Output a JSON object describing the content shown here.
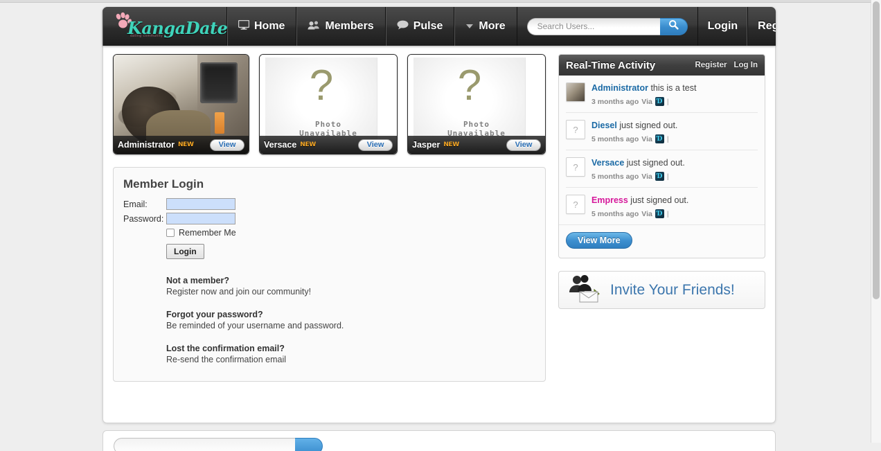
{
  "site": {
    "logo_text": "KangaDate",
    "logo_tagline": "dating community"
  },
  "nav": {
    "items": [
      {
        "label": "Home",
        "icon": "monitor-icon"
      },
      {
        "label": "Members",
        "icon": "people-icon"
      },
      {
        "label": "Pulse",
        "icon": "speech-bubble-icon"
      },
      {
        "label": "More",
        "icon": "chevron-down-icon"
      }
    ],
    "search": {
      "placeholder": "Search Users...",
      "value": "",
      "button_icon": "search-icon"
    },
    "auth": {
      "login": "Login",
      "register": "Register"
    }
  },
  "cards": [
    {
      "name": "Administrator",
      "badge": "NEW",
      "view": "View",
      "photo": "available",
      "placeholder_line1": "",
      "placeholder_line2": ""
    },
    {
      "name": "Versace",
      "badge": "NEW",
      "view": "View",
      "photo": "unavailable",
      "placeholder_line1": "Photo",
      "placeholder_line2": "Unavailable",
      "qmark": "?"
    },
    {
      "name": "Jasper",
      "badge": "NEW",
      "view": "View",
      "photo": "unavailable",
      "placeholder_line1": "Photo",
      "placeholder_line2": "Unavailable",
      "qmark": "?"
    }
  ],
  "login": {
    "title": "Member Login",
    "email_label": "Email:",
    "email_value": "",
    "password_label": "Password:",
    "password_value": "",
    "remember_label": "Remember Me",
    "remember_checked": false,
    "submit_label": "Login",
    "help": [
      {
        "question": "Not a member?",
        "answer": "Register now and join our community!"
      },
      {
        "question": "Forgot your password?",
        "answer": "Be reminded of your username and password."
      },
      {
        "question": "Lost the confirmation email?",
        "answer": "Re-send the confirmation email"
      }
    ]
  },
  "activity": {
    "title": "Real-Time Activity",
    "register_link": "Register",
    "login_link": "Log In",
    "items": [
      {
        "user": "Administrator",
        "user_color": "blue",
        "action": "this is a test",
        "time": "3 months ago",
        "via_label": "Via",
        "via_icon": "app-icon",
        "avatar": "photo"
      },
      {
        "user": "Diesel",
        "user_color": "blue",
        "action": "just signed out.",
        "time": "5 months ago",
        "via_label": "Via",
        "via_icon": "app-icon",
        "avatar": "?"
      },
      {
        "user": "Versace",
        "user_color": "blue",
        "action": "just signed out.",
        "time": "5 months ago",
        "via_label": "Via",
        "via_icon": "app-icon",
        "avatar": "?"
      },
      {
        "user": "Empress",
        "user_color": "pink",
        "action": "just signed out.",
        "time": "5 months ago",
        "via_label": "Via",
        "via_icon": "app-icon",
        "avatar": "?"
      }
    ],
    "view_more": "View More"
  },
  "invite": {
    "text": "Invite Your Friends!",
    "icon": "people-envelope-icon"
  },
  "colors": {
    "accent_blue": "#3d8fcf",
    "link_blue": "#1b6aa5",
    "pink_user": "#d6189b",
    "badge_orange": "#f5a623",
    "logo_teal": "#3fd4bb",
    "page_bg": "#eeeeee"
  }
}
